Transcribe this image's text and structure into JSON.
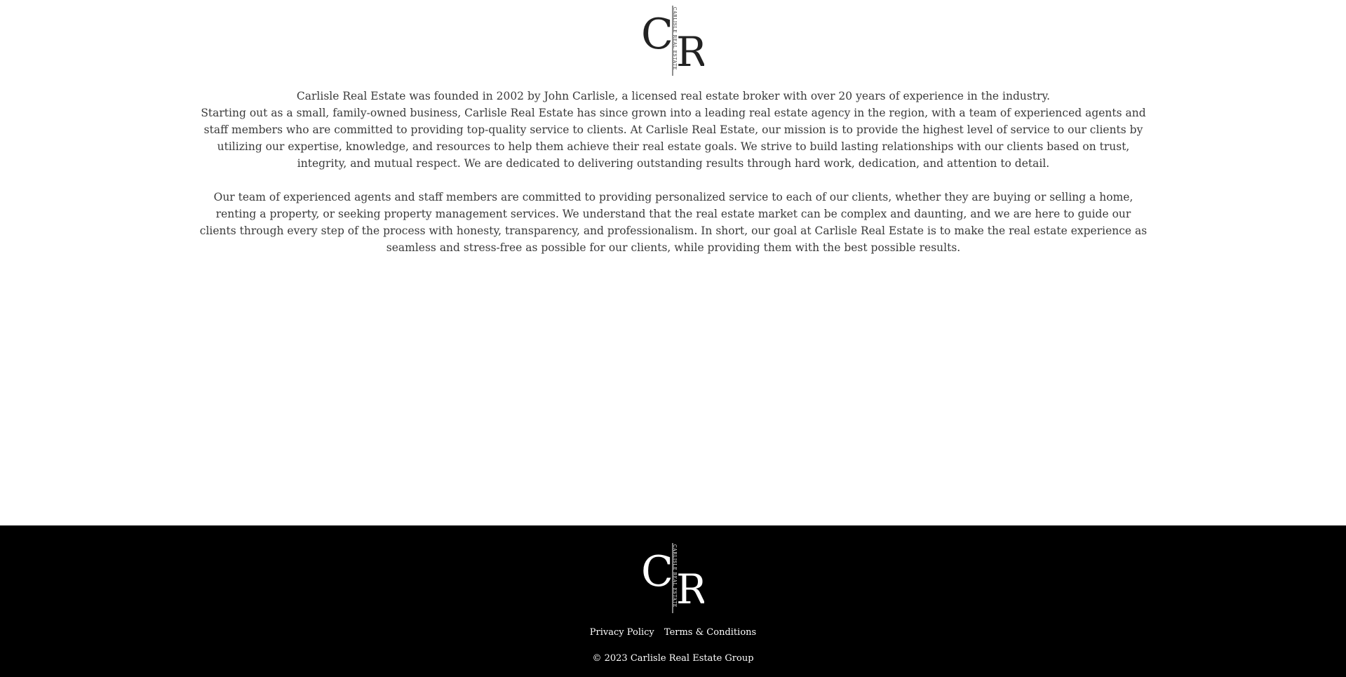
{
  "brand": {
    "initial_c": "C",
    "initial_r": "R",
    "vertical_text": "CARLISLE REAL ESTATE"
  },
  "about": {
    "paragraph_1_line_1": "Carlisle Real Estate was founded in 2002 by John Carlisle, a licensed real estate broker with over 20 years of experience in the industry.",
    "paragraph_1_rest": "Starting out as a small, family-owned business, Carlisle Real Estate has since grown into a leading real estate agency in the region, with a team of experienced agents and staff members who are committed to providing top-quality service to clients. At Carlisle Real Estate, our mission is to provide the highest level of service to our clients by utilizing our expertise, knowledge, and resources to help them achieve their real estate goals. We strive to build lasting relationships with our clients based on trust, integrity, and mutual respect. We are dedicated to delivering outstanding results through hard work, dedication, and attention to detail.",
    "paragraph_2": "Our team of experienced agents and staff members are committed to providing personalized service to each of our clients, whether they are buying or selling a home, renting a property, or seeking property management services. We understand that the real estate market can be complex and daunting, and we are here to guide our clients through every step of the process with honesty, transparency, and professionalism. In short, our goal at Carlisle Real Estate is to make the real estate experience as seamless and stress-free as possible for our clients, while providing them with the best possible results."
  },
  "footer": {
    "privacy_label": "Privacy Policy",
    "terms_label": "Terms & Conditions",
    "copyright": "© 2023 Carlisle Real Estate Group"
  },
  "colors": {
    "page_background": "#ffffff",
    "footer_background": "#000000",
    "body_text": "#3a3a3a",
    "logo_dark": "#222222",
    "logo_light": "#ffffff"
  }
}
